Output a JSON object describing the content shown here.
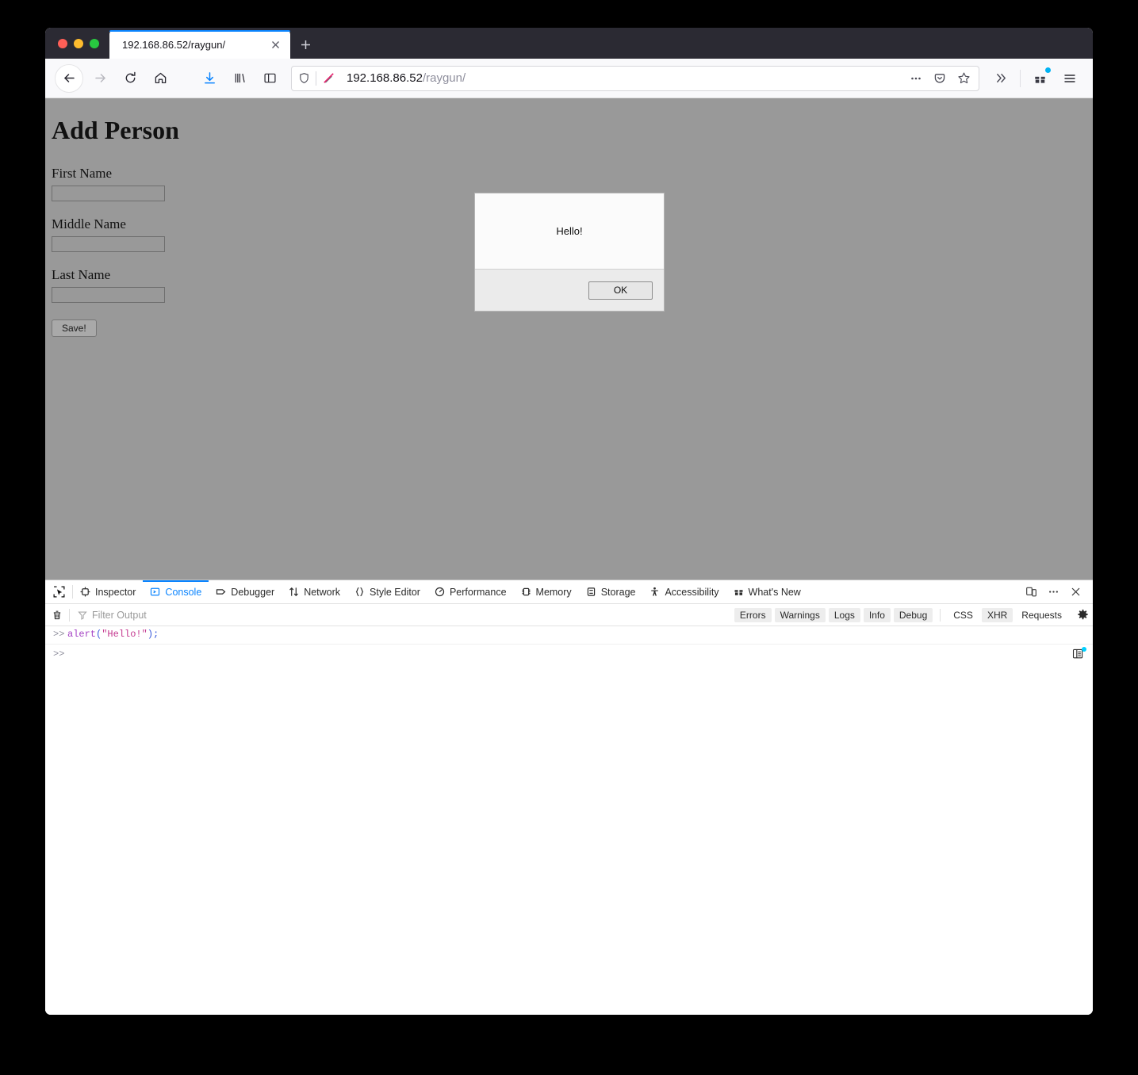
{
  "browser": {
    "tab": {
      "title": "192.168.86.52/raygun/",
      "close_icon": "close-icon",
      "new_tab_icon": "plus-icon"
    },
    "traffic_lights": {
      "close": "#ff5f57",
      "minimize": "#febc2e",
      "maximize": "#28c840"
    },
    "nav": {
      "back_icon": "back-arrow-icon",
      "forward_icon": "forward-arrow-icon",
      "reload_icon": "reload-icon",
      "home_icon": "home-icon",
      "downloads_icon": "downloads-icon",
      "library_icon": "library-icon",
      "sidebar_icon": "sidebar-icon"
    },
    "url_bar": {
      "shield_icon": "shield-icon",
      "insecure_icon": "insecure-pencil-icon",
      "host": "192.168.86.52",
      "path": "/raygun/",
      "full_url": "192.168.86.52/raygun/",
      "page_actions_icon": "ellipsis-icon",
      "pocket_icon": "pocket-save-icon",
      "bookmark_icon": "star-bookmark-icon"
    },
    "toolbar_right": {
      "overflow_icon": "chevrons-right-icon",
      "extension_icon": "gift-extension-icon",
      "extension_badge_color": "#00b3f4",
      "menu_icon": "hamburger-menu-icon"
    }
  },
  "page": {
    "title": "Add Person",
    "fields": [
      {
        "label": "First Name",
        "value": "",
        "name": "first-name"
      },
      {
        "label": "Middle Name",
        "value": "",
        "name": "middle-name"
      },
      {
        "label": "Last Name",
        "value": "",
        "name": "last-name"
      }
    ],
    "save_label": "Save!",
    "background_color": "#999999"
  },
  "alert": {
    "message": "Hello!",
    "ok_label": "OK"
  },
  "devtools": {
    "picker_icon": "element-picker-icon",
    "tabs": [
      {
        "label": "Inspector",
        "icon": "inspector-target-icon",
        "active": false
      },
      {
        "label": "Console",
        "icon": "console-prompt-icon",
        "active": true
      },
      {
        "label": "Debugger",
        "icon": "debugger-tag-icon",
        "active": false
      },
      {
        "label": "Network",
        "icon": "network-arrows-icon",
        "active": false
      },
      {
        "label": "Style Editor",
        "icon": "style-braces-icon",
        "active": false
      },
      {
        "label": "Performance",
        "icon": "performance-gauge-icon",
        "active": false
      },
      {
        "label": "Memory",
        "icon": "memory-chip-icon",
        "active": false
      },
      {
        "label": "Storage",
        "icon": "storage-database-icon",
        "active": false
      },
      {
        "label": "Accessibility",
        "icon": "accessibility-person-icon",
        "active": false
      },
      {
        "label": "What's New",
        "icon": "gift-icon",
        "active": false
      }
    ],
    "active_tab_color": "#0a84ff",
    "right_controls": {
      "responsive_icon": "responsive-design-mode-icon",
      "meatball_icon": "ellipsis-icon",
      "close_icon": "close-icon"
    },
    "console": {
      "clear_icon": "trash-icon",
      "filter_icon": "funnel-icon",
      "filter_placeholder": "Filter Output",
      "filter_buttons": [
        {
          "label": "Errors",
          "active": true
        },
        {
          "label": "Warnings",
          "active": true
        },
        {
          "label": "Logs",
          "active": true
        },
        {
          "label": "Info",
          "active": true
        },
        {
          "label": "Debug",
          "active": true
        }
      ],
      "request_filters": [
        {
          "label": "CSS",
          "active": false
        },
        {
          "label": "XHR",
          "active": true
        },
        {
          "label": "Requests",
          "active": false
        }
      ],
      "settings_icon": "gear-icon",
      "entries": [
        {
          "prompt": ">>",
          "tokens": [
            {
              "text": "alert",
              "type": "function"
            },
            {
              "text": "(",
              "type": "punct"
            },
            {
              "text": "\"Hello!\"",
              "type": "string"
            },
            {
              "text": ")",
              "type": "punct"
            },
            {
              "text": ";",
              "type": "punct"
            }
          ],
          "raw": "alert(\"Hello!\");"
        }
      ],
      "input_prompt": ">>",
      "input_value": "",
      "split_console_icon": "split-console-icon",
      "split_badge_color": "#00d0ff"
    }
  }
}
